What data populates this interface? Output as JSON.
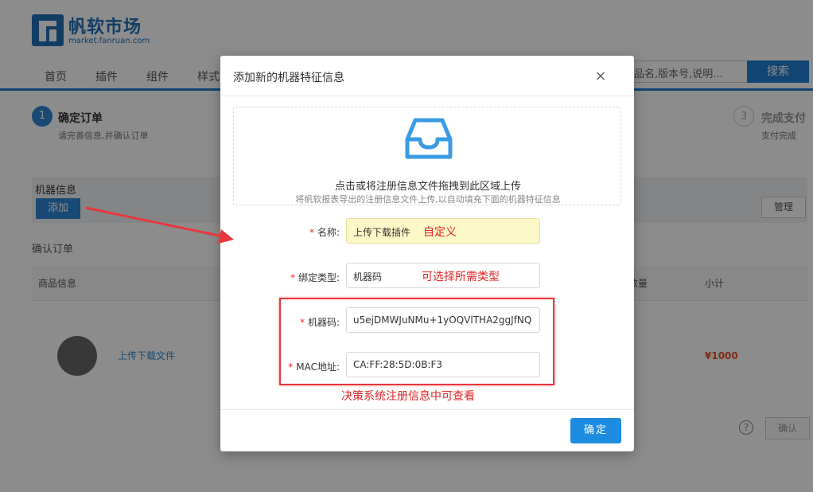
{
  "header": {
    "logo_title": "帆软市场",
    "logo_url": "market.fanruan.com",
    "nav": [
      "首页",
      "插件",
      "组件",
      "样式"
    ],
    "search_placeholder": "品名,版本号,说明...",
    "search_label": "搜索"
  },
  "steps": {
    "step1_number": "1",
    "step1_title": "确定订单",
    "step1_desc": "请完善信息,并确认订单",
    "step3_number": "3",
    "step3_title": "完成支付",
    "step3_desc": "支付完成"
  },
  "machine_panel": {
    "title": "机器信息",
    "add_label": "添加",
    "manage_label": "管理"
  },
  "order": {
    "confirm_label": "确认订单",
    "columns": [
      "商品信息",
      "数量",
      "小计"
    ],
    "product_name": "上传下载文件",
    "price": "¥1000",
    "help": "?",
    "confirm_label_btn": "确认"
  },
  "modal": {
    "title": "添加新的机器特征信息",
    "close": "×",
    "upload_main": "点击或将注册信息文件拖拽到此区域上传",
    "upload_hint": "将帆软报表导出的注册信息文件上传,以自动填充下面的机器特征信息",
    "required_mark": "*",
    "name_label": "名称:",
    "name_value": "上传下载插件",
    "bind_type_label": "绑定类型:",
    "bind_type_value": "机器码",
    "machine_code_label": "机器码:",
    "machine_code_value": "u5ejDMWJuNMu+1yOQVlTHA2ggJfNQ",
    "mac_label": "MAC地址:",
    "mac_value": "CA:FF:28:5D:0B:F3",
    "ok_label": "确定"
  },
  "annotations": {
    "custom": "自定义",
    "select_type": "可选择所需类型",
    "viewable": "决策系统注册信息中可查看"
  },
  "colors": {
    "accent": "#1d8ce0",
    "annotation_red": "#e02424",
    "name_highlight": "#fcf8c8"
  }
}
